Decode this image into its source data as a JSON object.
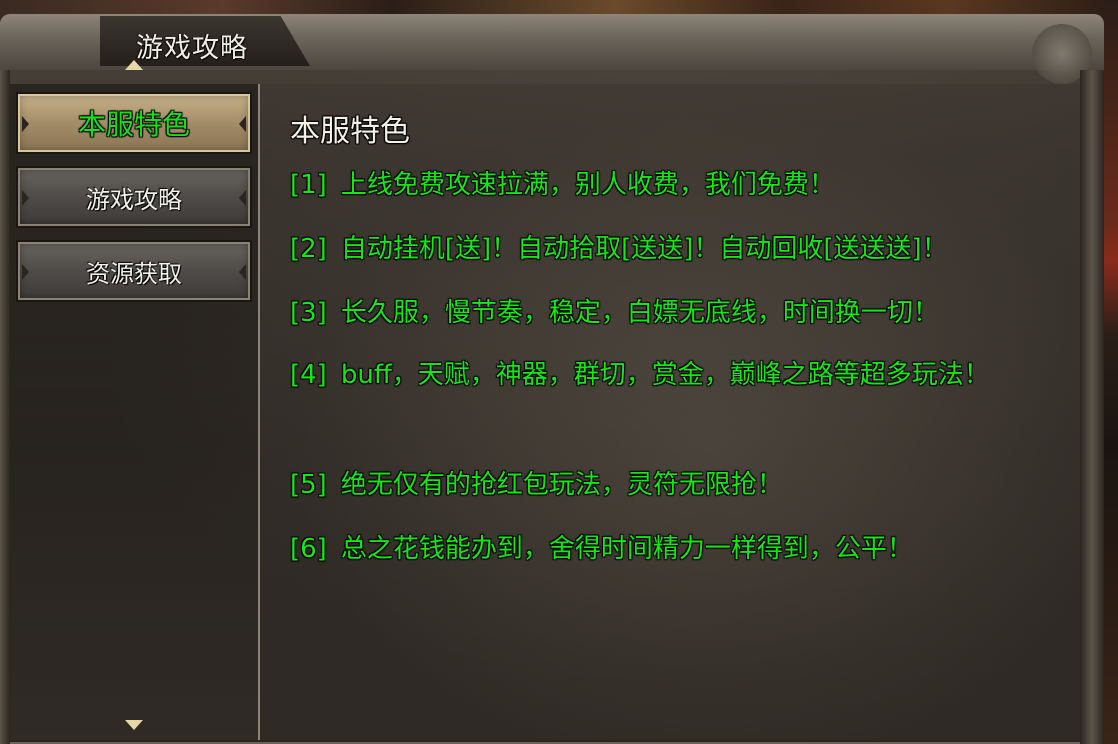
{
  "window": {
    "title": "游戏攻略"
  },
  "sidebar": {
    "items": [
      {
        "label": "本服特色",
        "active": true
      },
      {
        "label": "游戏攻略",
        "active": false
      },
      {
        "label": "资源获取",
        "active": false
      }
    ]
  },
  "main": {
    "heading": "本服特色",
    "lines": [
      {
        "num": "[1]",
        "text": "上线免费攻速拉满，别人收费，我们免费！"
      },
      {
        "num": "[2]",
        "text": "自动挂机[送]！自动拾取[送送]！自动回收[送送送]！"
      },
      {
        "num": "[3]",
        "text": "长久服，慢节奏，稳定，白嫖无底线，时间换一切！"
      },
      {
        "num": "[4]",
        "text": "buff，天赋，神器，群切，赏金，巅峰之路等超多玩法！"
      },
      {
        "num": "[5]",
        "text": "绝无仅有的抢红包玩法，灵符无限抢！"
      },
      {
        "num": "[6]",
        "text": "总之花钱能办到，舍得时间精力一样得到，公平！"
      }
    ]
  },
  "colors": {
    "highlight_green": "#12e812",
    "active_tab_bg": "#a38c68",
    "text_white": "#f5f0e6"
  }
}
